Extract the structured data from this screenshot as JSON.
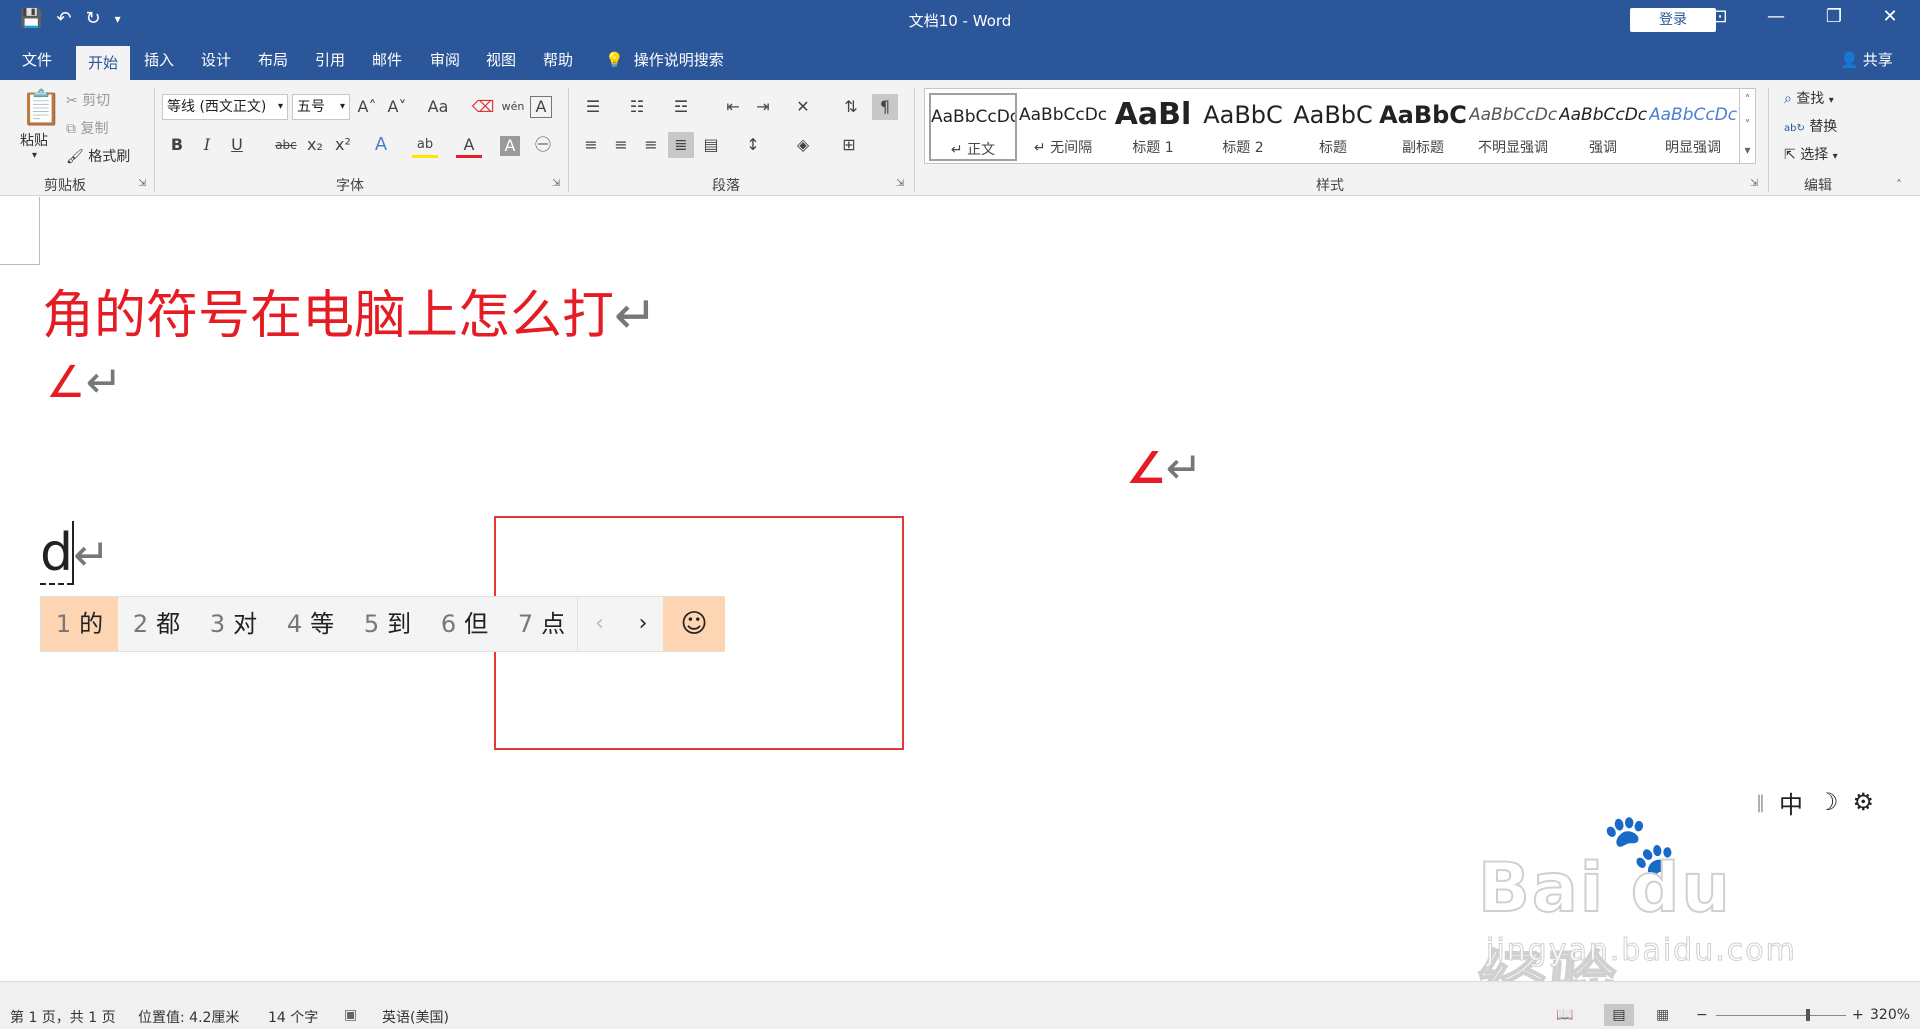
{
  "window": {
    "title": "文档10  -  Word",
    "login_label": "登录",
    "controls": {
      "ribbon_display": "⊡",
      "minimize": "—",
      "restore": "❐",
      "close": "✕"
    }
  },
  "qat": {
    "save": "💾",
    "undo": "↶",
    "redo": "↻",
    "more": "▾"
  },
  "tabs": [
    "文件",
    "开始",
    "插入",
    "设计",
    "布局",
    "引用",
    "邮件",
    "审阅",
    "视图",
    "帮助"
  ],
  "tellme": "操作说明搜索",
  "share": "共享",
  "ribbon": {
    "clipboard": {
      "label": "剪贴板",
      "paste": "粘贴",
      "cut": "剪切",
      "copy": "复制",
      "format_painter": "格式刷"
    },
    "font": {
      "label": "字体",
      "font_name": "等线 (西文正文)",
      "font_size": "五号",
      "bold": "B",
      "italic": "I",
      "underline": "U",
      "strike": "abc",
      "subscript": "x₂",
      "superscript": "x²",
      "grow": "A˄",
      "shrink": "A˅",
      "case": "Aa",
      "wen": "wén",
      "phonetic": "文",
      "border_char": "A",
      "text_effect": "A",
      "highlight": "ab",
      "font_color": "A",
      "shading": "A",
      "enclose": "㊀"
    },
    "paragraph": {
      "label": "段落"
    },
    "styles": {
      "label": "样式",
      "items": [
        {
          "sample": "AaBbCcDc",
          "name": "↵ 正文"
        },
        {
          "sample": "AaBbCcDc",
          "name": "↵ 无间隔"
        },
        {
          "sample": "AaBl",
          "name": "标题 1"
        },
        {
          "sample": "AaBbC",
          "name": "标题 2"
        },
        {
          "sample": "AaBbC",
          "name": "标题"
        },
        {
          "sample": "AaBbC",
          "name": "副标题"
        },
        {
          "sample": "AaBbCcDc",
          "name": "不明显强调"
        },
        {
          "sample": "AaBbCcDc",
          "name": "强调"
        },
        {
          "sample": "AaBbCcDc",
          "name": "明显强调"
        }
      ]
    },
    "editing": {
      "label": "编辑",
      "find": "查找",
      "replace": "替换",
      "select": "选择"
    }
  },
  "document": {
    "line1": "角的符号在电脑上怎么打",
    "angle_symbol": "∠",
    "typed": "d",
    "para_mark": "↵"
  },
  "ime": {
    "candidates": [
      {
        "num": "1",
        "text": "的"
      },
      {
        "num": "2",
        "text": "都"
      },
      {
        "num": "3",
        "text": "对"
      },
      {
        "num": "4",
        "text": "等"
      },
      {
        "num": "5",
        "text": "到"
      },
      {
        "num": "6",
        "text": "但"
      },
      {
        "num": "7",
        "text": "点"
      }
    ],
    "prev": "‹",
    "next": "›",
    "emoji": "☺",
    "status": {
      "handle": "‖",
      "mode": "中",
      "moon": "☽",
      "gear": "⚙"
    }
  },
  "watermark": {
    "brand": "Bai du 经验",
    "url": "jingyan.baidu.com"
  },
  "statusbar": {
    "page": "第 1 页，共 1 页",
    "position": "位置值: 4.2厘米",
    "words": "14 个字",
    "proof_icon": "▣",
    "language": "英语(美国)",
    "zoom_out": "−",
    "zoom_in": "+",
    "zoom": "320%"
  },
  "colors": {
    "title_bg": "#2b579a",
    "doc_red": "#e51c23",
    "candidate_selected": "#fdd5b2",
    "highlight_box": "#e53935"
  }
}
